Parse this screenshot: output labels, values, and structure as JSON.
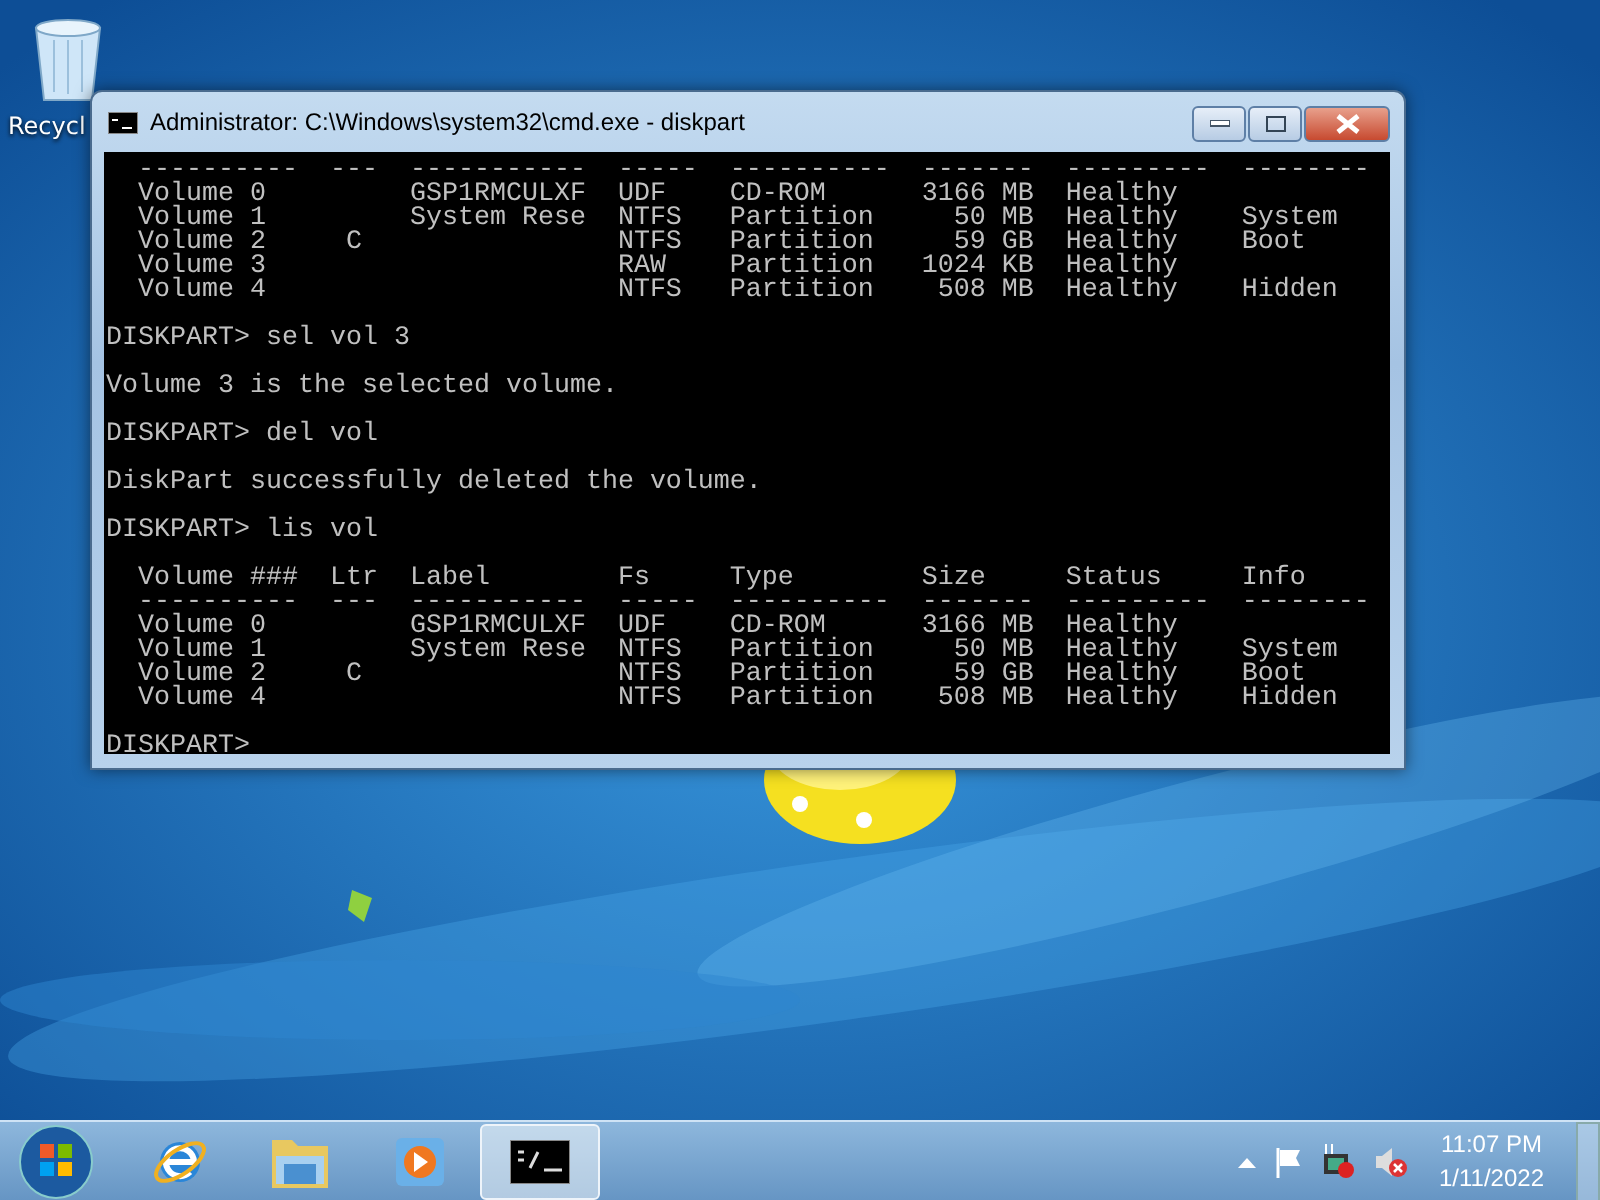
{
  "desktop": {
    "icons": [
      {
        "label": "Recycl"
      }
    ]
  },
  "window": {
    "title": "Administrator: C:\\Windows\\system32\\cmd.exe - diskpart"
  },
  "console": {
    "blocks": [
      [
        "  ----------  ---  -----------  -----  ----------  -------  ---------  --------",
        "  Volume 0         GSP1RMCULXF  UDF    CD-ROM      3166 MB  Healthy",
        "  Volume 1         System Rese  NTFS   Partition     50 MB  Healthy    System",
        "  Volume 2     C                NTFS   Partition     59 GB  Healthy    Boot",
        "  Volume 3                      RAW    Partition   1024 KB  Healthy",
        "  Volume 4                      NTFS   Partition    508 MB  Healthy    Hidden"
      ],
      [
        "DISKPART> sel vol 3"
      ],
      [
        "Volume 3 is the selected volume."
      ],
      [
        "DISKPART> del vol"
      ],
      [
        "DiskPart successfully deleted the volume."
      ],
      [
        "DISKPART> lis vol"
      ],
      [
        "  Volume ###  Ltr  Label        Fs     Type        Size     Status     Info",
        "  ----------  ---  -----------  -----  ----------  -------  ---------  --------",
        "  Volume 0         GSP1RMCULXF  UDF    CD-ROM      3166 MB  Healthy",
        "  Volume 1         System Rese  NTFS   Partition     50 MB  Healthy    System",
        "  Volume 2     C                NTFS   Partition     59 GB  Healthy    Boot",
        "  Volume 4                      NTFS   Partition    508 MB  Healthy    Hidden"
      ]
    ],
    "prompt": "DISKPART> "
  },
  "taskbar": {
    "apps": [
      {
        "kind": "ie",
        "selected": false
      },
      {
        "kind": "explorer",
        "selected": false
      },
      {
        "kind": "media",
        "selected": false
      },
      {
        "kind": "cmd",
        "selected": true
      }
    ],
    "clock": {
      "time": "11:07 PM",
      "date": "1/11/2022"
    }
  }
}
